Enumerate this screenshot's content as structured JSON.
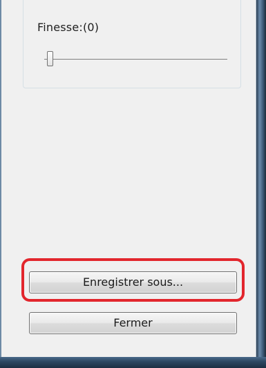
{
  "settings": {
    "finesse_label": "Finesse:(0)",
    "finesse_value": 0
  },
  "buttons": {
    "save_as_label": "Enregistrer sous...",
    "close_label": "Fermer"
  },
  "colors": {
    "highlight": "#e2262d",
    "panel_background": "#f0f0f0"
  }
}
